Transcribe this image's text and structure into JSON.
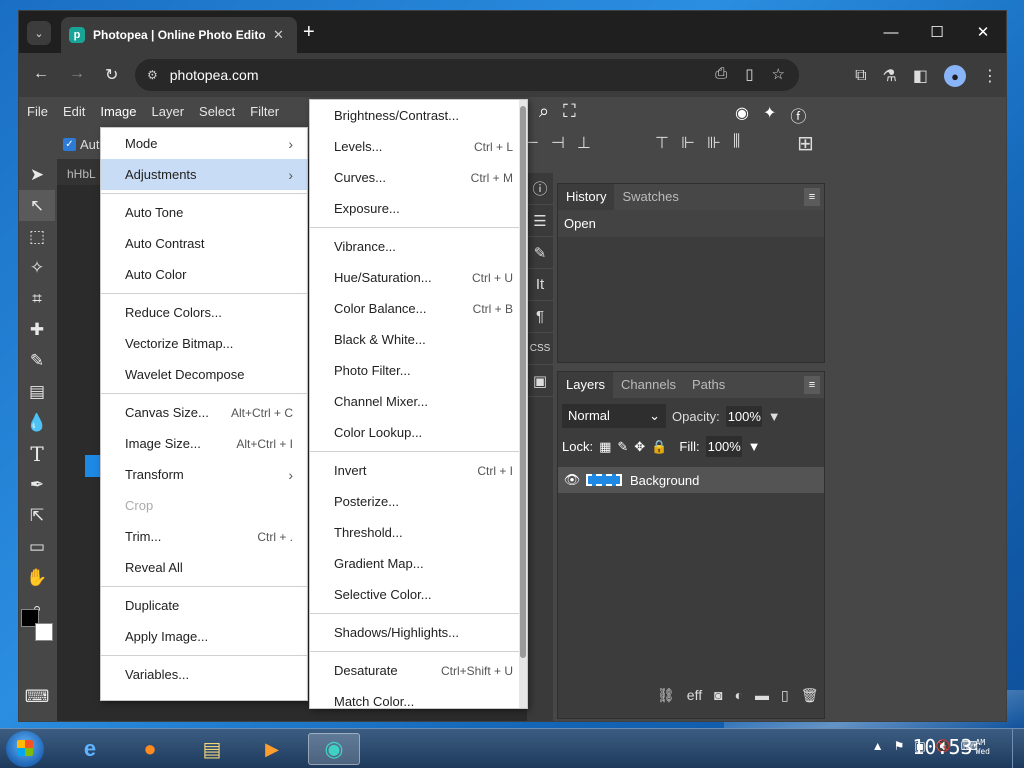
{
  "browser": {
    "tab_title": "Photopea | Online Photo Editor",
    "url": "photopea.com",
    "tab_favicon_letter": "p"
  },
  "photopea": {
    "menubar": [
      "File",
      "Edit",
      "Image",
      "Layer",
      "Select",
      "Filter"
    ],
    "options_auto": "Auto",
    "doc_tab": "hHbL",
    "panels": {
      "history_tabs": [
        "History",
        "Swatches"
      ],
      "history_items": [
        "Open"
      ],
      "layers_tabs": [
        "Layers",
        "Channels",
        "Paths"
      ],
      "blend_mode": "Normal",
      "opacity_label": "Opacity:",
      "opacity_value": "100%",
      "lock_label": "Lock:",
      "fill_label": "Fill:",
      "fill_value": "100%",
      "layers": [
        {
          "name": "Background"
        }
      ]
    }
  },
  "image_menu": {
    "items": [
      {
        "label": "Mode",
        "arrow": "›"
      },
      {
        "label": "Adjustments",
        "arrow": "›",
        "state": "hover"
      },
      {
        "sep": true
      },
      {
        "label": "Auto Tone"
      },
      {
        "label": "Auto Contrast"
      },
      {
        "label": "Auto Color"
      },
      {
        "sep": true
      },
      {
        "label": "Reduce Colors..."
      },
      {
        "label": "Vectorize Bitmap..."
      },
      {
        "label": "Wavelet Decompose"
      },
      {
        "sep": true
      },
      {
        "label": "Canvas Size...",
        "shortcut": "Alt+Ctrl + C"
      },
      {
        "label": "Image Size...",
        "shortcut": "Alt+Ctrl + I"
      },
      {
        "label": "Transform",
        "arrow": "›"
      },
      {
        "label": "Crop",
        "state": "disabled"
      },
      {
        "label": "Trim...",
        "shortcut": "Ctrl + ."
      },
      {
        "label": "Reveal All"
      },
      {
        "sep": true
      },
      {
        "label": "Duplicate"
      },
      {
        "label": "Apply Image..."
      },
      {
        "sep": true
      },
      {
        "label": "Variables..."
      }
    ]
  },
  "adjustments_menu": {
    "items": [
      {
        "label": "Brightness/Contrast..."
      },
      {
        "label": "Levels...",
        "shortcut": "Ctrl + L"
      },
      {
        "label": "Curves...",
        "shortcut": "Ctrl + M"
      },
      {
        "label": "Exposure..."
      },
      {
        "sep": true
      },
      {
        "label": "Vibrance..."
      },
      {
        "label": "Hue/Saturation...",
        "shortcut": "Ctrl + U"
      },
      {
        "label": "Color Balance...",
        "shortcut": "Ctrl + B"
      },
      {
        "label": "Black & White..."
      },
      {
        "label": "Photo Filter..."
      },
      {
        "label": "Channel Mixer..."
      },
      {
        "label": "Color Lookup..."
      },
      {
        "sep": true
      },
      {
        "label": "Invert",
        "shortcut": "Ctrl + I"
      },
      {
        "label": "Posterize..."
      },
      {
        "label": "Threshold..."
      },
      {
        "label": "Gradient Map..."
      },
      {
        "label": "Selective Color..."
      },
      {
        "sep": true
      },
      {
        "label": "Shadows/Highlights..."
      },
      {
        "sep": true
      },
      {
        "label": "Desaturate",
        "shortcut": "Ctrl+Shift + U"
      },
      {
        "label": "Match Color..."
      }
    ]
  },
  "taskbar": {
    "clock_time": "10:53",
    "clock_ampm": "AM",
    "clock_day": "Wed"
  },
  "colors": {
    "accent": "#1e88e5",
    "menu_hover": "#c9dcf5",
    "app_bg": "#474747"
  }
}
